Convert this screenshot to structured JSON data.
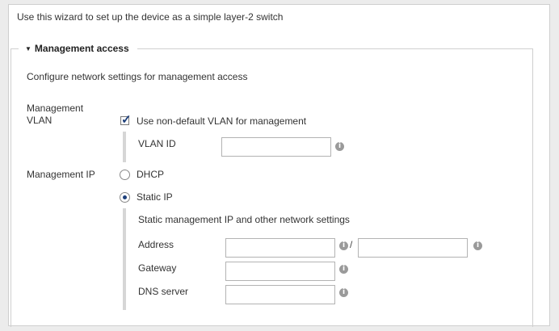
{
  "intro": "Use this wizard to set up the device as a simple layer-2 switch",
  "section": {
    "title": "Management access",
    "icon": "triangle-down-icon",
    "description": "Configure network settings for management access"
  },
  "vlan": {
    "label_line1": "Management",
    "label_line2": "VLAN",
    "checkbox_label": "Use non-default VLAN for management",
    "checked": true,
    "vlan_id_label": "VLAN ID",
    "vlan_id_value": ""
  },
  "ip": {
    "label": "Management IP",
    "dhcp_label": "DHCP",
    "static_label": "Static IP",
    "selected": "Static IP",
    "static_heading": "Static management IP and other network settings",
    "address_label": "Address",
    "address_value": "",
    "prefix_value": "",
    "separator": "/",
    "gateway_label": "Gateway",
    "gateway_value": "",
    "dns_label": "DNS server",
    "dns_value": ""
  },
  "info_icon": "i",
  "colors": {
    "accent": "#1d3f7a",
    "border": "#b3b3b3",
    "background": "#ececec"
  }
}
